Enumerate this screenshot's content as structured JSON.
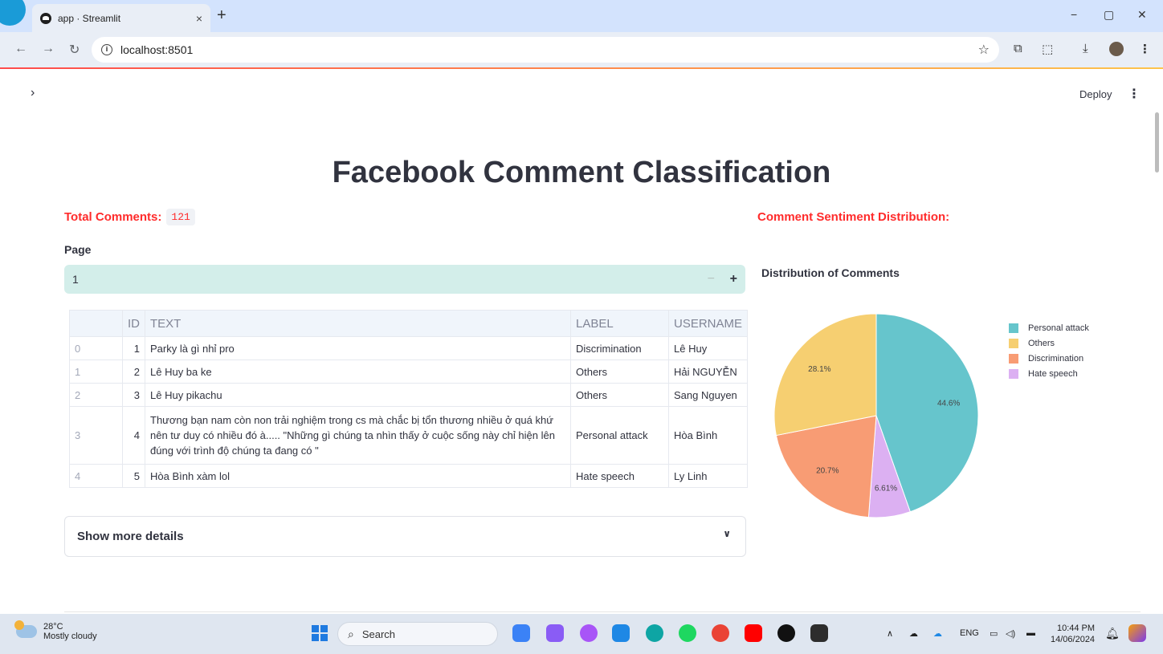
{
  "browser": {
    "tab_title": "app · Streamlit",
    "tab_close": "×",
    "new_tab": "+",
    "url": "localhost:8501",
    "window_controls": [
      "−",
      "▢",
      "✕"
    ]
  },
  "streamlit": {
    "deploy_label": "Deploy",
    "sidebar_toggle": "›",
    "menu": "⋮"
  },
  "main": {
    "title": "Facebook Comment Classification",
    "total_label": "Total Comments:",
    "total_value": "121",
    "page_label": "Page",
    "page_value": "1",
    "expander_label": "Show more details"
  },
  "table": {
    "columns": [
      "",
      "ID",
      "TEXT",
      "LABEL",
      "USERNAME"
    ],
    "rows": [
      {
        "index": "0",
        "id": "1",
        "text": "Parky là gì nhỉ pro",
        "label": "Discrimination",
        "username": "Lê Huy"
      },
      {
        "index": "1",
        "id": "2",
        "text": "Lê Huy ba ke",
        "label": "Others",
        "username": "Hải NGUYỄN"
      },
      {
        "index": "2",
        "id": "3",
        "text": "Lê Huy pikachu",
        "label": "Others",
        "username": "Sang Nguyen"
      },
      {
        "index": "3",
        "id": "4",
        "text": "Thương bạn nam còn non trải nghiệm trong cs mà chắc bị tổn thương nhiều ở quá khứ nên tư duy có nhiều đó à..... \"Những gì chúng ta nhìn thấy ở cuộc sống này chỉ hiện lên đúng với trình độ chúng ta đang có \"",
        "label": "Personal attack",
        "username": "Hòa Bình"
      },
      {
        "index": "4",
        "id": "5",
        "text": "Hòa Bình xàm lol",
        "label": "Hate speech",
        "username": "Ly Linh"
      }
    ]
  },
  "chart_section": {
    "heading": "Comment Sentiment Distribution:"
  },
  "chart_data": {
    "type": "pie",
    "title": "Distribution of Comments",
    "labels": [
      "Personal attack",
      "Hate speech",
      "Discrimination",
      "Others"
    ],
    "values": [
      44.6,
      6.61,
      20.7,
      28.1
    ],
    "value_labels": [
      "44.6%",
      "6.61%",
      "20.7%",
      "28.1%"
    ],
    "colors": [
      "#66c5cc",
      "#dcb0f2",
      "#f89c74",
      "#f6cf71"
    ],
    "legend": [
      "Personal attack",
      "Others",
      "Discrimination",
      "Hate speech"
    ],
    "legend_colors": [
      "#66c5cc",
      "#f6cf71",
      "#f89c74",
      "#dcb0f2"
    ],
    "legend_position": "right"
  },
  "taskbar": {
    "temperature": "28°C",
    "weather": "Mostly cloudy",
    "search_placeholder": "Search",
    "language": "ENG",
    "time": "10:44 PM",
    "date": "14/06/2024"
  }
}
